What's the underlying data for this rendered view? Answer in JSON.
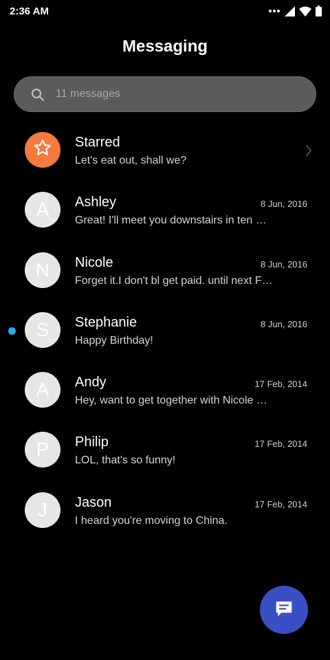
{
  "status_bar": {
    "time": "2:36 AM"
  },
  "header": {
    "title": "Messaging"
  },
  "search": {
    "placeholder": "11 messages"
  },
  "starred": {
    "name": "Starred",
    "preview": "Let's eat out, shall we?",
    "accent_color": "#f47a3e"
  },
  "conversations": [
    {
      "initial": "A",
      "name": "Ashley",
      "date": "8 Jun, 2016",
      "preview": "Great! I'll meet you downstairs in ten …",
      "unread": false
    },
    {
      "initial": "N",
      "name": "Nicole",
      "date": "8 Jun, 2016",
      "preview": "Forget it.I don't bl get paid. until next F…",
      "unread": false
    },
    {
      "initial": "S",
      "name": "Stephanie",
      "date": "8 Jun, 2016",
      "preview": "Happy Birthday!",
      "unread": true
    },
    {
      "initial": "A",
      "name": "Andy",
      "date": "17 Feb, 2014",
      "preview": "Hey, want to get together with Nicole …",
      "unread": false
    },
    {
      "initial": "P",
      "name": "Philip",
      "date": "17 Feb, 2014",
      "preview": "LOL, that's so funny!",
      "unread": false
    },
    {
      "initial": "J",
      "name": "Jason",
      "date": "17 Feb, 2014",
      "preview": "I heard you're moving to China.",
      "unread": false
    }
  ],
  "colors": {
    "background": "#000000",
    "fab": "#3b4fc4",
    "unread_dot": "#35a3ee"
  },
  "icons": {
    "search": "search-icon",
    "star": "star-icon",
    "chevron": "chevron-right-icon",
    "fab": "compose-message-icon"
  }
}
